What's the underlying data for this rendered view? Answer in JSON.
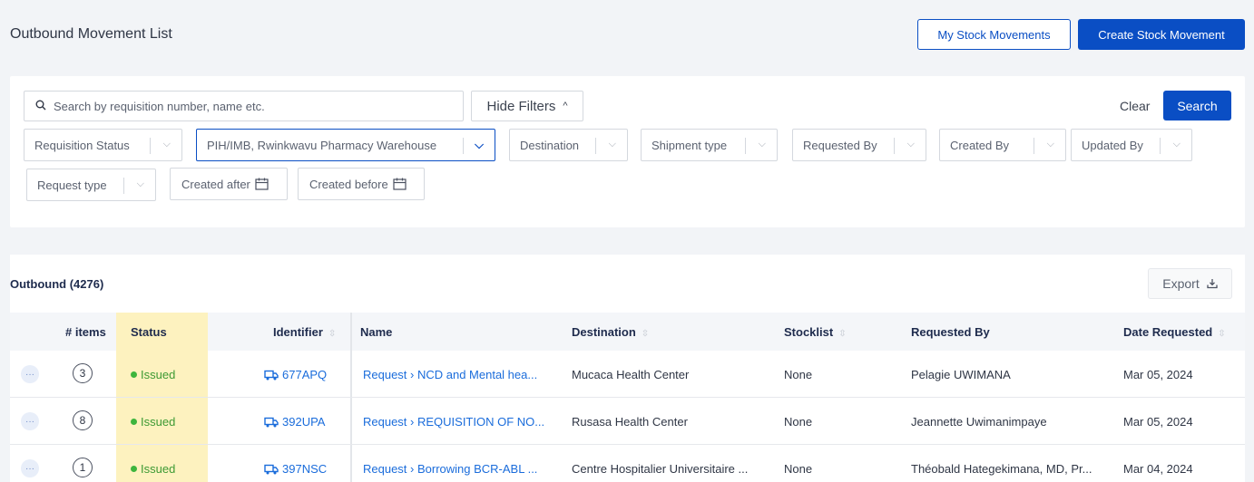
{
  "header": {
    "title": "Outbound Movement List",
    "my_stock_label": "My Stock Movements",
    "create_label": "Create Stock Movement"
  },
  "filters": {
    "search_placeholder": "Search by requisition number, name etc.",
    "hide_filters_label": "Hide Filters",
    "clear_label": "Clear",
    "search_label": "Search",
    "requisition_status": "Requisition Status",
    "origin_selected": "PIH/IMB, Rwinkwavu Pharmacy Warehouse",
    "destination": "Destination",
    "shipment_type": "Shipment type",
    "requested_by": "Requested By",
    "created_by": "Created By",
    "updated_by": "Updated By",
    "request_type": "Request type",
    "created_after": "Created after",
    "created_before": "Created before"
  },
  "table": {
    "title": "Outbound (4276)",
    "export_label": "Export",
    "columns": {
      "items": "# items",
      "status": "Status",
      "identifier": "Identifier",
      "name": "Name",
      "destination": "Destination",
      "stocklist": "Stocklist",
      "requested_by": "Requested By",
      "date_requested": "Date Requested"
    },
    "rows": [
      {
        "menu": "···",
        "items": "3",
        "status": "Issued",
        "identifier": "677APQ",
        "name": "Request › NCD and Mental hea...",
        "destination": "Mucaca Health Center",
        "stocklist": "None",
        "requested_by": "Pelagie UWIMANA",
        "date": "Mar 05, 2024"
      },
      {
        "menu": "···",
        "items": "8",
        "status": "Issued",
        "identifier": "392UPA",
        "name": "Request › REQUISITION OF NO...",
        "destination": "Rusasa Health Center",
        "stocklist": "None",
        "requested_by": "Jeannette Uwimanimpaye",
        "date": "Mar 05, 2024"
      },
      {
        "menu": "···",
        "items": "1",
        "status": "Issued",
        "identifier": "397NSC",
        "name": "Request › Borrowing BCR-ABL ...",
        "destination": "Centre Hospitalier Universitaire ...",
        "stocklist": "None",
        "requested_by": "Théobald Hategekimana, MD, Pr...",
        "date": "Mar 04, 2024"
      }
    ]
  },
  "colors": {
    "primary": "#0a4ec4",
    "link": "#1a6cdb",
    "status_highlight": "#fdf2bf",
    "issued": "#3db53d"
  }
}
